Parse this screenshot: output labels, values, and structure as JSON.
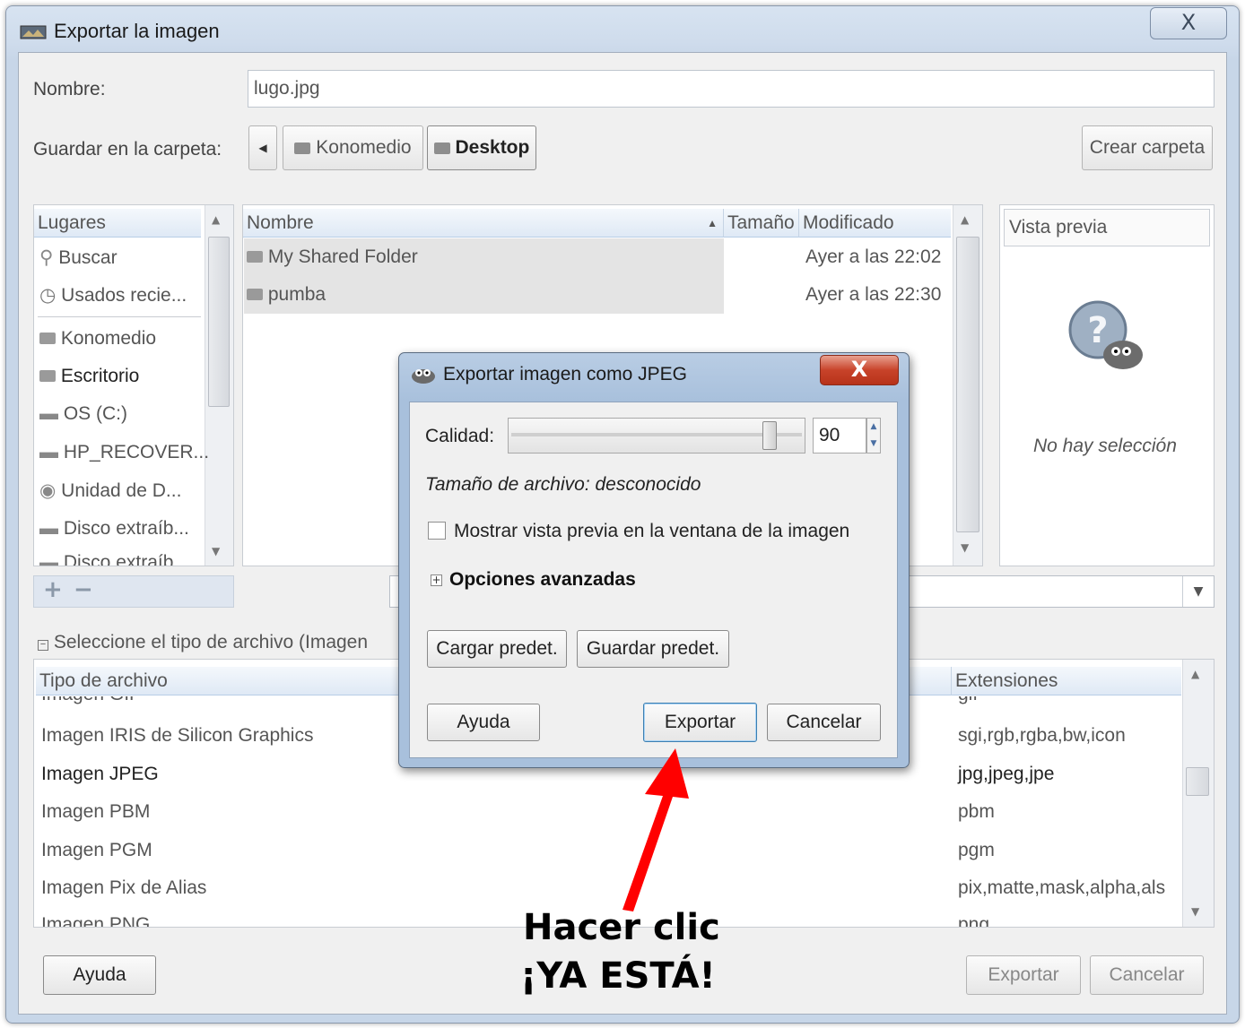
{
  "window": {
    "title": "Exportar la imagen",
    "close_glyph": "X"
  },
  "form": {
    "name_label": "Nombre:",
    "name_value": "lugo.jpg",
    "folder_label": "Guardar en la carpeta:",
    "breadcrumb": [
      "Konomedio",
      "Desktop"
    ],
    "create_folder_label": "Crear carpeta"
  },
  "places": {
    "header": "Lugares",
    "items": [
      "Buscar",
      "Usados recie...",
      "Konomedio",
      "Escritorio",
      "OS (C:)",
      "HP_RECOVER...",
      "Unidad de D...",
      "Disco extraíb...",
      "Disco extraíb..."
    ]
  },
  "files": {
    "columns": {
      "name": "Nombre",
      "size": "Tamaño",
      "modified": "Modificado"
    },
    "rows": [
      {
        "name": "My Shared Folder",
        "modified": "Ayer a las 22:02"
      },
      {
        "name": "pumba",
        "modified": "Ayer a las 22:30"
      }
    ]
  },
  "preview": {
    "header": "Vista previa",
    "empty_text": "No hay selección"
  },
  "filetype": {
    "toggle_label": "Seleccione el tipo de archivo (Imagen",
    "col_type": "Tipo de archivo",
    "col_ext": "Extensiones",
    "rows": [
      {
        "type": "Imagen GIF",
        "ext": "gif"
      },
      {
        "type": "Imagen IRIS de Silicon Graphics",
        "ext": "sgi,rgb,rgba,bw,icon"
      },
      {
        "type": "Imagen JPEG",
        "ext": "jpg,jpeg,jpe"
      },
      {
        "type": "Imagen PBM",
        "ext": "pbm"
      },
      {
        "type": "Imagen PGM",
        "ext": "pgm"
      },
      {
        "type": "Imagen Pix de Alias",
        "ext": "pix,matte,mask,alpha,als"
      },
      {
        "type": "Imagen PNG",
        "ext": "png"
      }
    ]
  },
  "footer": {
    "help": "Ayuda",
    "export": "Exportar",
    "cancel": "Cancelar"
  },
  "jpeg_dialog": {
    "title": "Exportar imagen como JPEG",
    "close_glyph": "X",
    "quality_label": "Calidad:",
    "quality_value": "90",
    "quality_fraction": 0.9,
    "file_size_text": "Tamaño de archivo: desconocido",
    "show_preview_label": "Mostrar vista previa en la ventana de la imagen",
    "advanced_label": "Opciones avanzadas",
    "load_defaults": "Cargar predet.",
    "save_defaults": "Guardar predet.",
    "help": "Ayuda",
    "export": "Exportar",
    "cancel": "Cancelar"
  },
  "annotation": {
    "line1": "Hacer clic",
    "line2": "¡YA ESTÁ!",
    "arrow_color": "#ff0000"
  }
}
